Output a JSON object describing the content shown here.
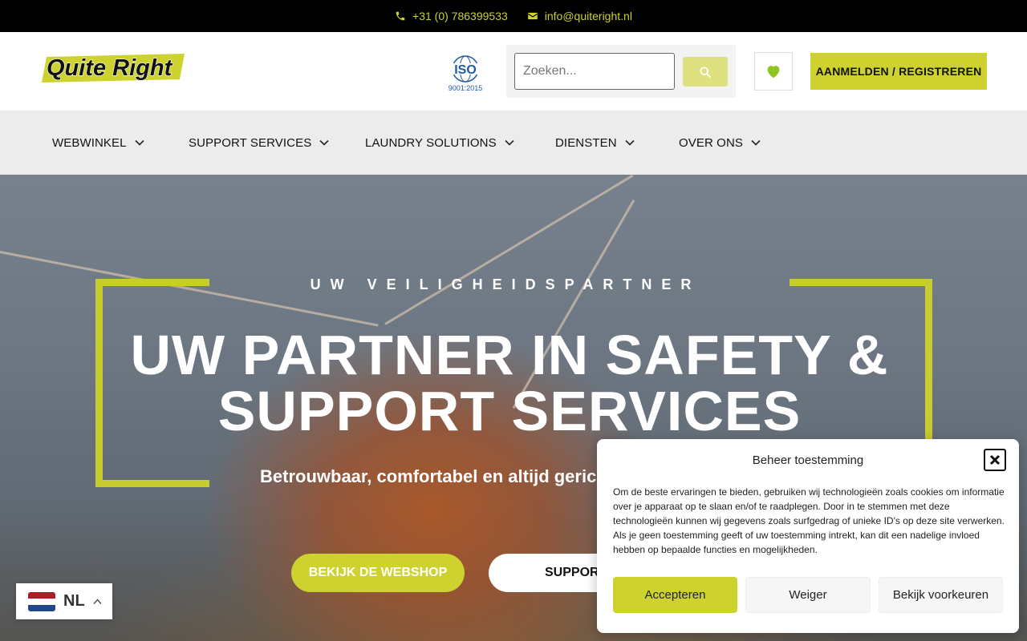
{
  "topbar": {
    "phone": "+31 (0) 786399533",
    "email": "info@quiteright.nl",
    "accent_color": "#cdd22f"
  },
  "header": {
    "logo_text": "Quite Right",
    "iso_main": "ISO",
    "iso_sub": "9001:2015",
    "search_placeholder": "Zoeken...",
    "login_label": "AANMELDEN / REGISTREREN"
  },
  "nav": {
    "items": [
      {
        "label": "WEBWINKEL"
      },
      {
        "label": "SUPPORT SERVICES"
      },
      {
        "label": "LAUNDRY SOLUTIONS"
      },
      {
        "label": "DIENSTEN"
      },
      {
        "label": "OVER ONS"
      }
    ]
  },
  "hero": {
    "kicker": "UW VEILIGHEIDSPARTNER",
    "title_line1": "UW PARTNER IN SAFETY &",
    "title_line2": "SUPPORT SERVICES",
    "subtitle": "Betrouwbaar, comfortabel en altijd geric",
    "btn_shop": "BEKIJK DE WEBSHOP",
    "btn_support": "SUPPOR"
  },
  "language": {
    "code": "NL"
  },
  "cookie": {
    "title": "Beheer toestemming",
    "text": "Om de beste ervaringen te bieden, gebruiken wij technologieën zoals cookies om informatie over je apparaat op te slaan en/of te raadplegen. Door in te stemmen met deze technologieën kunnen wij gegevens zoals surfgedrag of unieke ID's op deze site verwerken. Als je geen toestemming geeft of uw toestemming intrekt, kan dit een nadelige invloed hebben op bepaalde functies en mogelijkheden.",
    "accept_label": "Accepteren",
    "deny_label": "Weiger",
    "prefs_label": "Bekijk voorkeuren"
  },
  "colors": {
    "brand_lime": "#cdd22f",
    "nav_bg": "#ececec",
    "topbar_bg": "#000000"
  }
}
